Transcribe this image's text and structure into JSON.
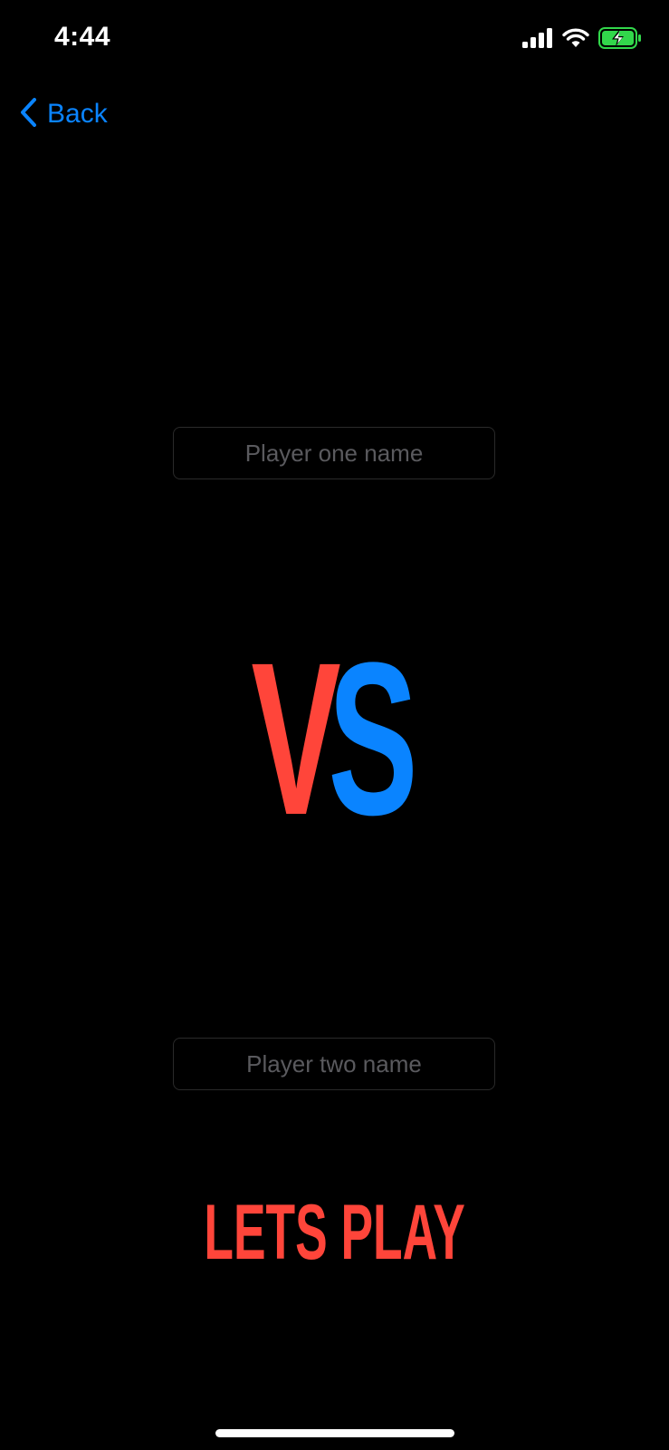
{
  "status_bar": {
    "time": "4:44",
    "icons": [
      "cellular-signal-icon",
      "wifi-icon",
      "battery-charging-icon"
    ]
  },
  "nav": {
    "back_label": "Back"
  },
  "player_one": {
    "placeholder": "Player one name",
    "value": ""
  },
  "vs": {
    "left_letter": "V",
    "right_letter": "S"
  },
  "player_two": {
    "placeholder": "Player two name",
    "value": ""
  },
  "play_button": {
    "label": "LETS PLAY"
  },
  "colors": {
    "background": "#000000",
    "accent_blue": "#0a84ff",
    "accent_red": "#ff453a",
    "battery_green": "#32d74b",
    "placeholder_gray": "#5a5a5e"
  }
}
